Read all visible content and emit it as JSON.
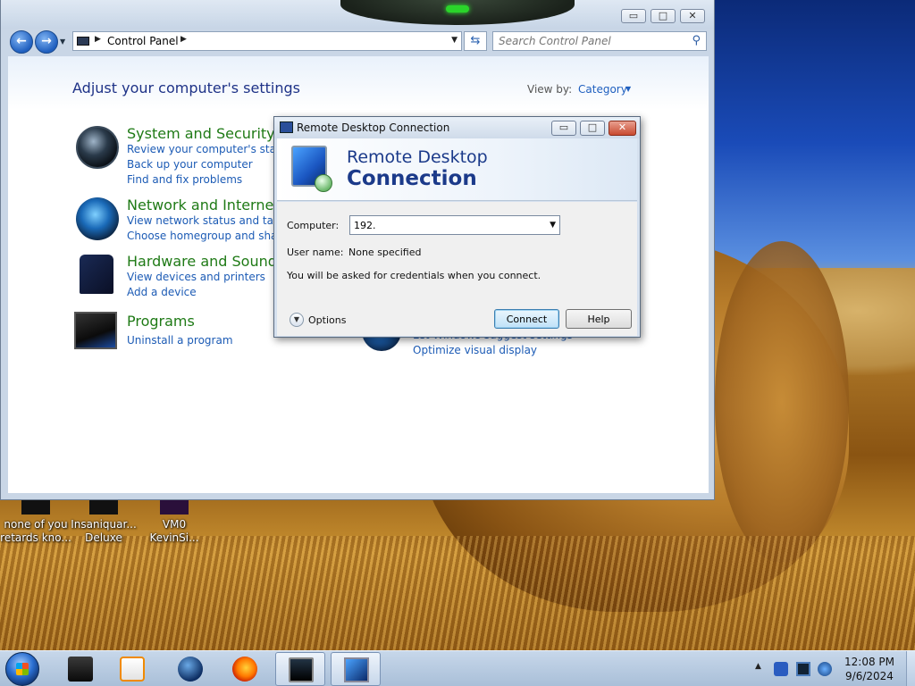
{
  "desktop": {
    "icons": [
      {
        "label_line1": "none of you",
        "label_line2": "retards kno..."
      },
      {
        "label_line1": "Insaniquar...",
        "label_line2": "Deluxe"
      },
      {
        "label_line1": "VM0",
        "label_line2": "KevinSi..."
      }
    ]
  },
  "control_panel": {
    "address": {
      "crumb": "Control Panel"
    },
    "search": {
      "placeholder": "Search Control Panel"
    },
    "heading": "Adjust your computer's settings",
    "view_by_label": "View by:",
    "view_by_value": "Category",
    "categories": [
      {
        "title": "System and Security",
        "links": [
          "Review your computer's status",
          "Back up your computer",
          "Find and fix problems"
        ]
      },
      {
        "title": "Network and Internet",
        "links": [
          "View network status and tasks",
          "Choose homegroup and sharin"
        ]
      },
      {
        "title": "Hardware and Sound",
        "links": [
          "View devices and printers",
          "Add a device"
        ]
      },
      {
        "title": "Programs",
        "links": [
          "Uninstall a program"
        ]
      }
    ],
    "ease_links": [
      "Let Windows suggest settings",
      "Optimize visual display"
    ]
  },
  "rdc": {
    "title": "Remote Desktop Connection",
    "banner_line1": "Remote Desktop",
    "banner_line2": "Connection",
    "computer_label": "Computer:",
    "computer_value": "192.",
    "username_label": "User name:",
    "username_value": "None specified",
    "credentials_note": "You will be asked for credentials when you connect.",
    "options_label": "Options",
    "connect_label": "Connect",
    "help_label": "Help"
  },
  "taskbar": {
    "clock_time": "12:08 PM",
    "clock_date": "9/6/2024"
  }
}
